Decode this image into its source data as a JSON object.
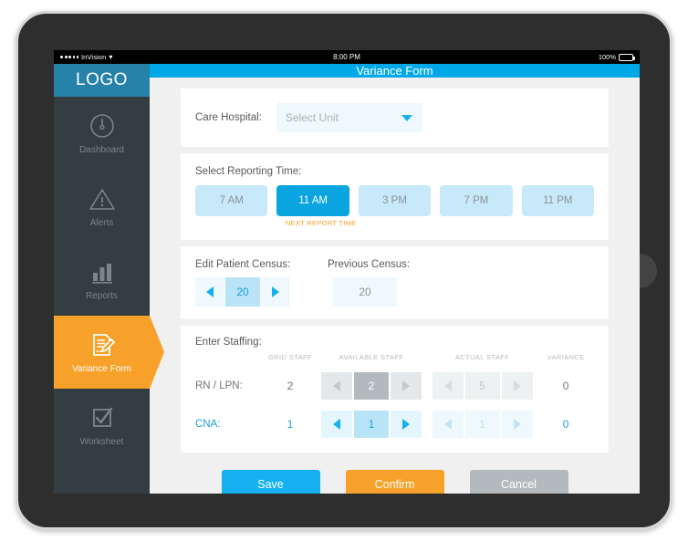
{
  "status_bar": {
    "carrier": "InVision",
    "wifi_icon": "wifi-icon",
    "time": "8:00 PM",
    "battery_percent": "100%"
  },
  "sidebar": {
    "logo": "LOGO",
    "items": [
      {
        "label": "Dashboard",
        "icon": "gauge-icon",
        "active": false
      },
      {
        "label": "Alerts",
        "icon": "warning-icon",
        "active": false
      },
      {
        "label": "Reports",
        "icon": "bar-chart-icon",
        "active": false
      },
      {
        "label": "Variance Form",
        "icon": "form-pen-icon",
        "active": true
      },
      {
        "label": "Worksheet",
        "icon": "checkbox-icon",
        "active": false
      }
    ]
  },
  "header": {
    "title": "Variance Form"
  },
  "unit_section": {
    "label": "Care Hospital:",
    "select_value": "Select Unit",
    "caret_icon": "chevron-down-icon"
  },
  "reporting_time": {
    "label": "Select Reporting Time:",
    "options": [
      "7 AM",
      "11 AM",
      "3 PM",
      "7 PM",
      "11 PM"
    ],
    "selected": "11 AM",
    "note": "NEXT REPORT TIME"
  },
  "census": {
    "edit_label": "Edit Patient Census:",
    "previous_label": "Previous Census:",
    "edit_value": "20",
    "previous_value": "20",
    "dec_icon": "arrow-left-icon",
    "inc_icon": "arrow-right-icon"
  },
  "staffing": {
    "label": "Enter Staffing:",
    "columns": [
      "",
      "GRID STAFF",
      "AVAILABLE STAFF",
      "ACTUAL STAFF",
      "VARIANCE"
    ],
    "rows": [
      {
        "name": "RN / LPN:",
        "grid_staff": "2",
        "available_staff": "2",
        "actual_staff": "5",
        "variance": "0",
        "state": "grey"
      },
      {
        "name": "CNA:",
        "grid_staff": "1",
        "available_staff": "1",
        "actual_staff": "1",
        "variance": "0",
        "state": "blue"
      }
    ]
  },
  "footer": {
    "save_label": "Save",
    "confirm_label": "Confirm",
    "cancel_label": "Cancel"
  },
  "colors": {
    "accent_blue": "#00a8e8",
    "accent_orange": "#f7a12a",
    "sidebar_bg": "#343d41",
    "logo_bg": "#2682a8",
    "cancel_grey": "#b3b9bc"
  }
}
